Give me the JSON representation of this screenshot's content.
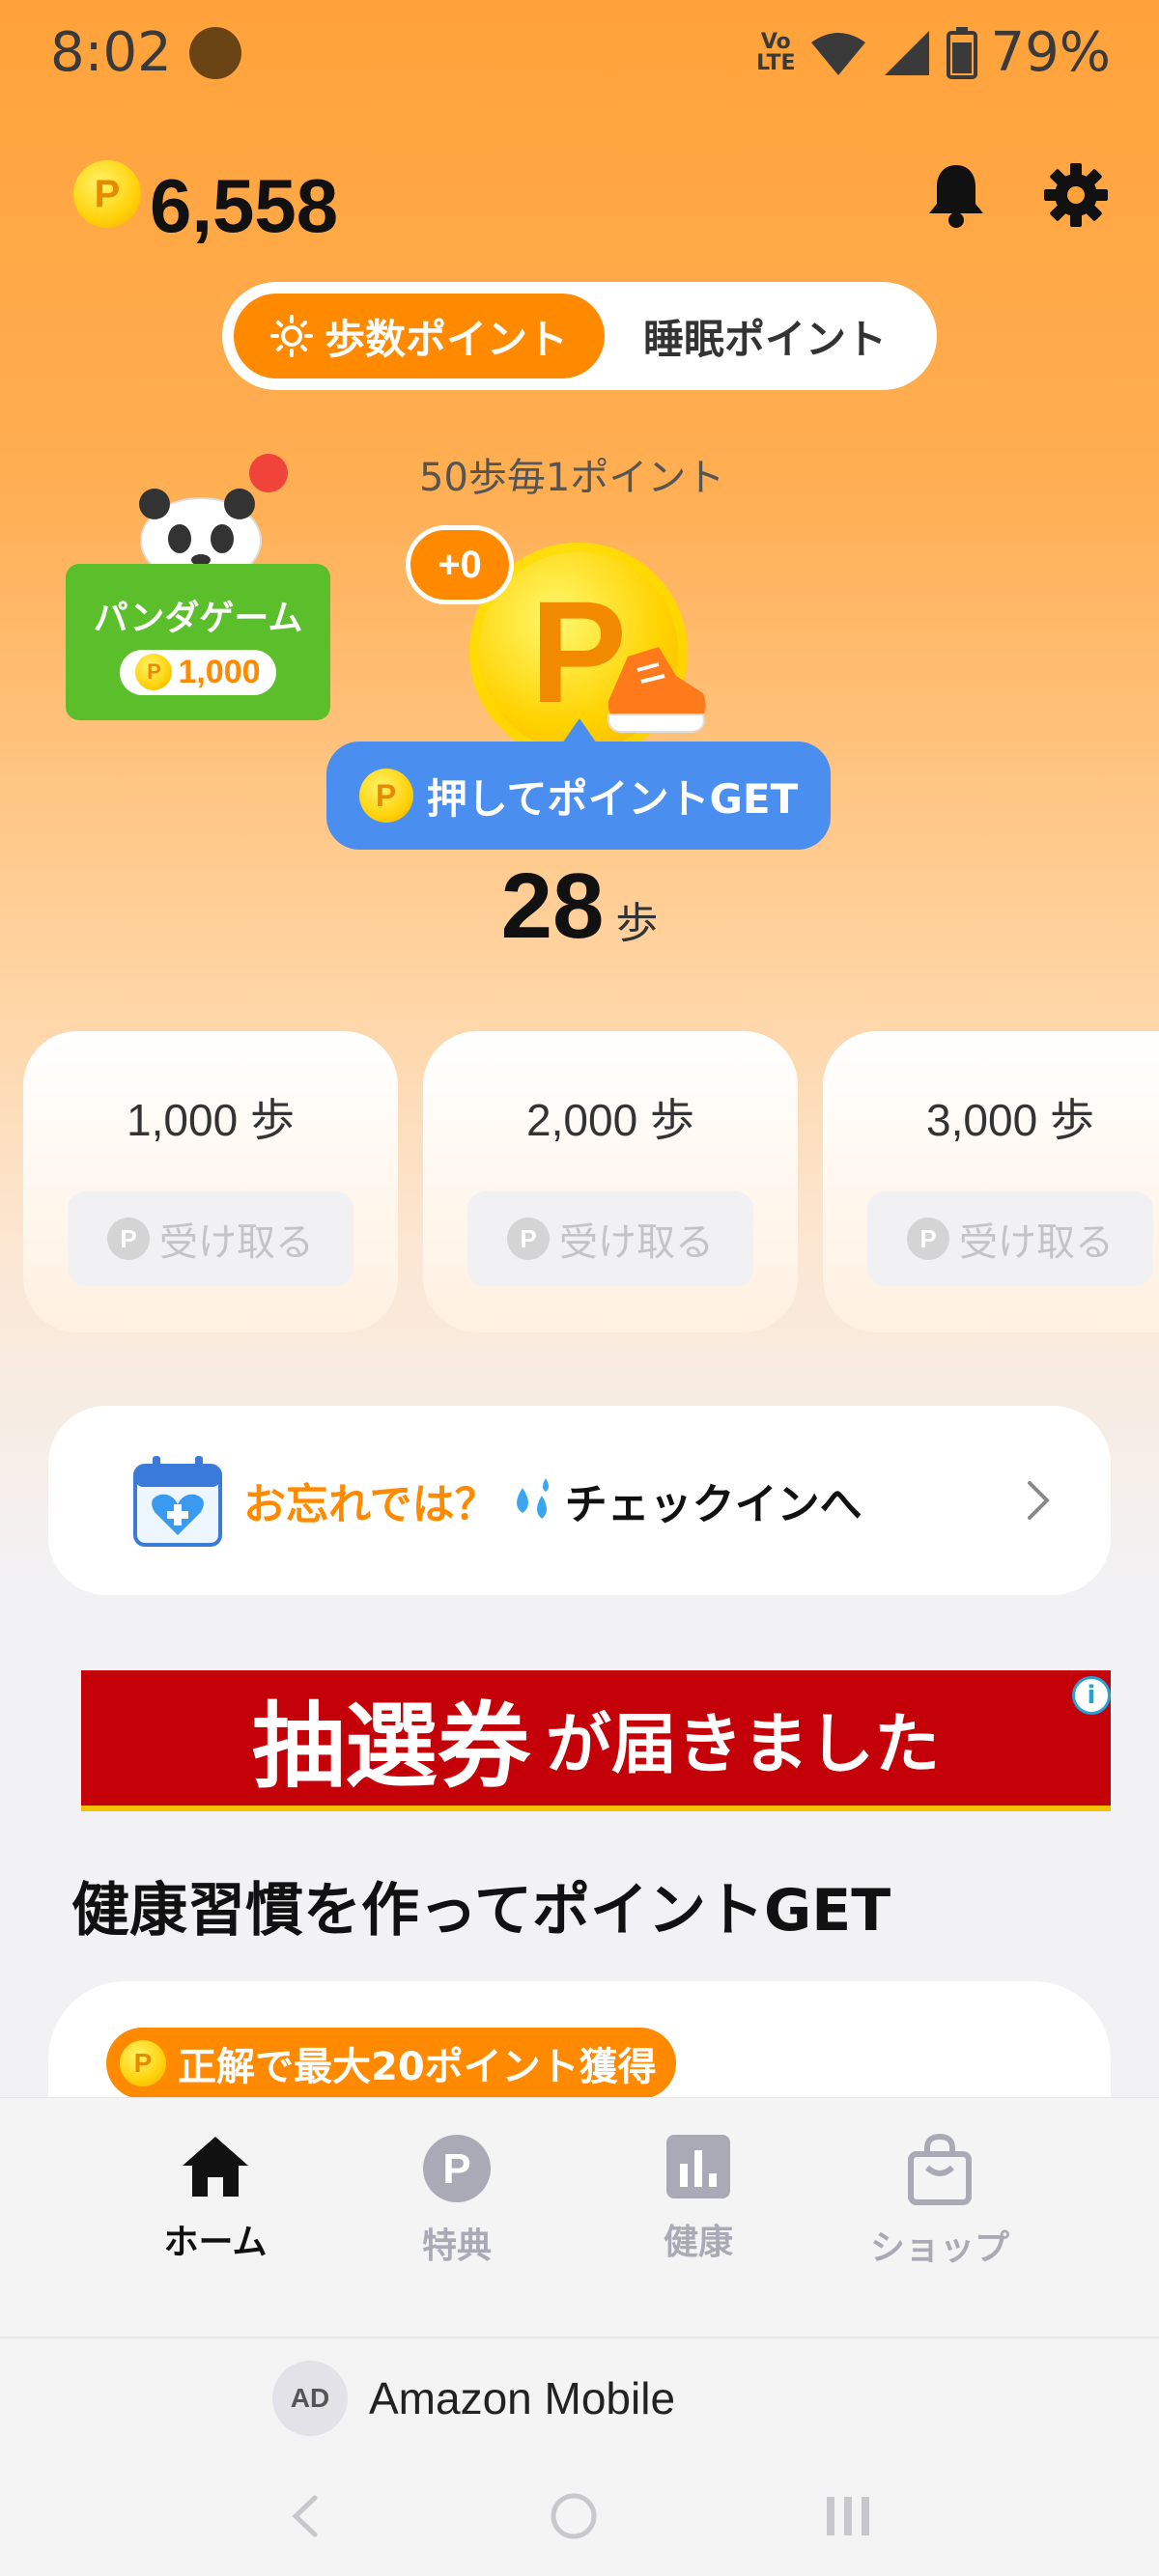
{
  "status_bar": {
    "time": "8:02",
    "volte": "Vo\nLTE",
    "battery_percent": "79%"
  },
  "header": {
    "points_total": "6,558",
    "coin_letter": "P",
    "notification_icon": "bell-icon",
    "settings_icon": "gear-icon"
  },
  "mode_tabs": {
    "active_label": "歩数ポイント",
    "inactive_label": "睡眠ポイント"
  },
  "rate_text": "50歩毎1ポイント",
  "panda_game": {
    "title": "パンダゲーム",
    "reward": "1,000"
  },
  "coin": {
    "letter": "P",
    "pending_badge": "+0",
    "get_button_label": "押してポイントGET"
  },
  "steps": {
    "count": "28",
    "unit": "歩"
  },
  "milestones": [
    {
      "steps": "1,000 歩",
      "button_label": "受け取る"
    },
    {
      "steps": "2,000 歩",
      "button_label": "受け取る"
    },
    {
      "steps": "3,000 歩",
      "button_label": "受け取る"
    }
  ],
  "checkin": {
    "orange_text": "お忘れでは？",
    "black_text": "チェックインへ"
  },
  "ad_banner": {
    "big_text": "抽選券",
    "small_text": "が届きました",
    "info_symbol": "i"
  },
  "section_title": "健康習慣を作ってポイントGET",
  "habit_card": {
    "badge_label": "正解で最大20ポイント獲得"
  },
  "bottom_nav": [
    {
      "label": "ホーム",
      "icon": "home-icon",
      "active": true
    },
    {
      "label": "特典",
      "icon": "points-icon",
      "active": false
    },
    {
      "label": "健康",
      "icon": "chart-icon",
      "active": false
    },
    {
      "label": "ショップ",
      "icon": "shopping-bag-icon",
      "active": false
    }
  ],
  "ad_bar": {
    "chip": "AD",
    "label": "Amazon Mobile"
  },
  "colors": {
    "accent": "#ff8a00",
    "button_blue": "#4a8ff0",
    "panda_green": "#5bbf2c",
    "ad_red": "#c40008"
  }
}
